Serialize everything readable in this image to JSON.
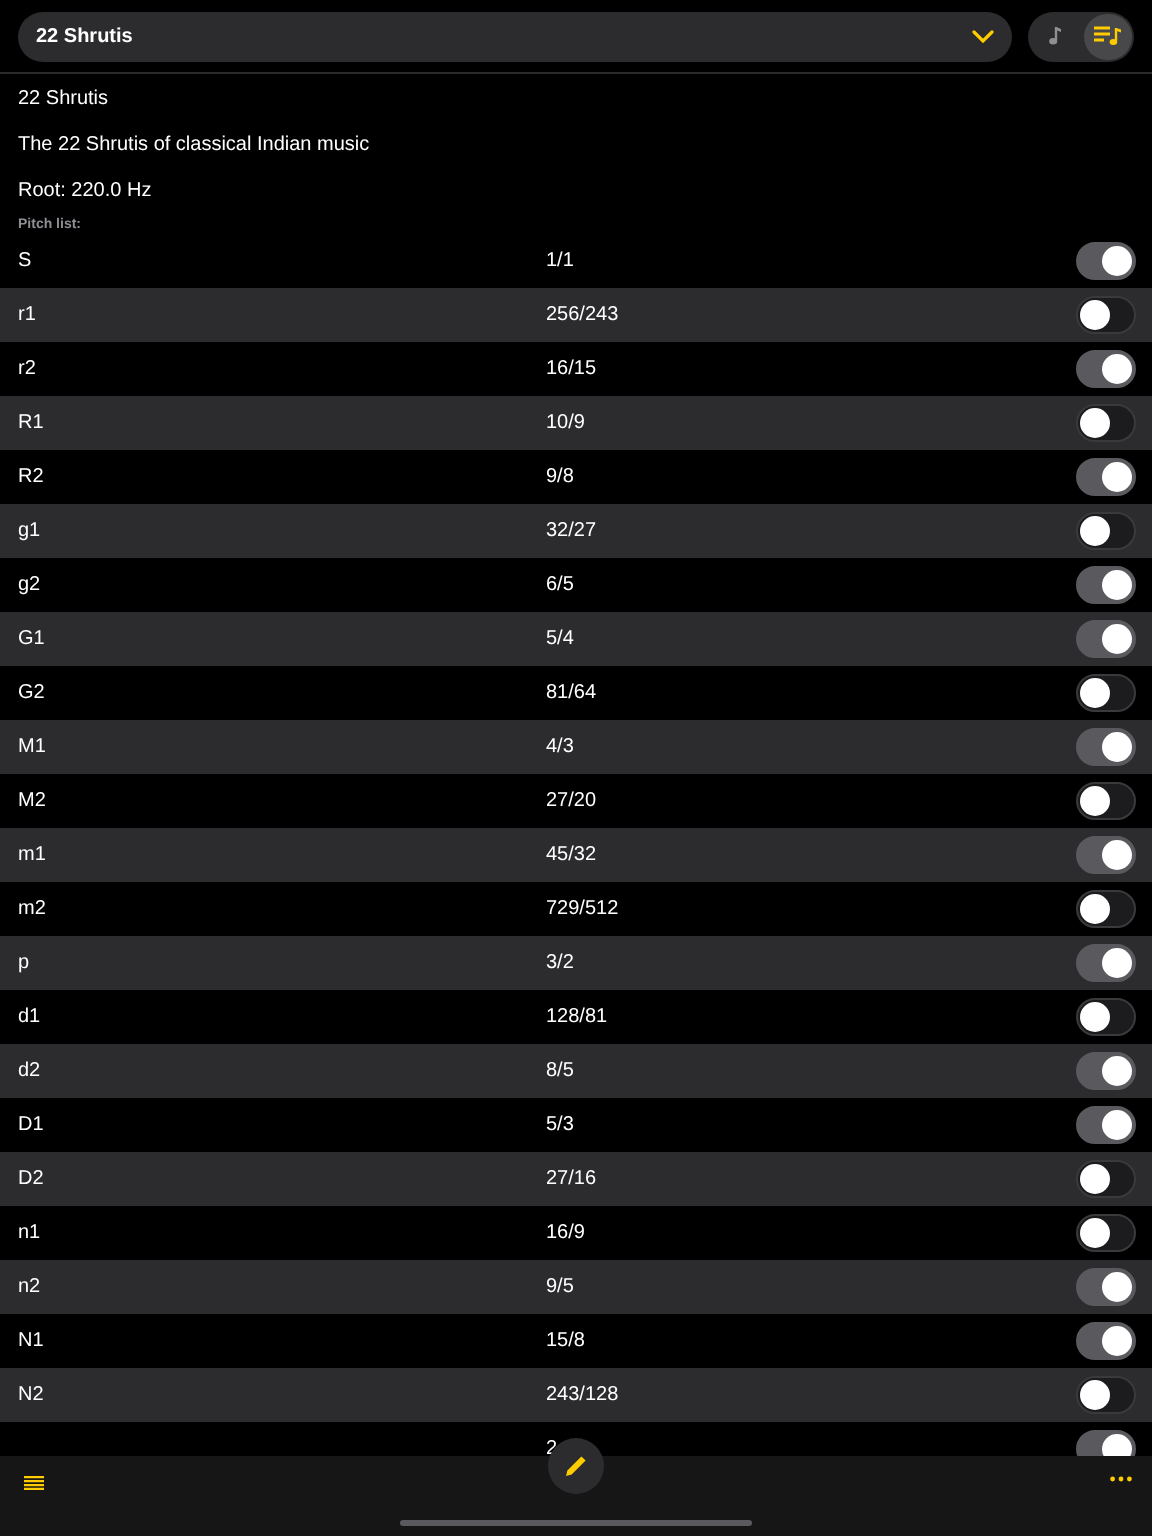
{
  "scale_picker": {
    "value": "22 Shrutis"
  },
  "mode_buttons": [
    {
      "kind": "note",
      "selected": false
    },
    {
      "kind": "list",
      "selected": true
    }
  ],
  "info": [
    "22 Shrutis",
    "The 22 Shrutis of classical Indian music",
    "Root: 220.0 Hz"
  ],
  "pitch_list_label": "Pitch list:",
  "pitches": [
    {
      "name": "S",
      "ratio": "1/1",
      "on": true
    },
    {
      "name": "r1",
      "ratio": "256/243",
      "on": false
    },
    {
      "name": "r2",
      "ratio": "16/15",
      "on": true
    },
    {
      "name": "R1",
      "ratio": "10/9",
      "on": false
    },
    {
      "name": "R2",
      "ratio": "9/8",
      "on": true
    },
    {
      "name": "g1",
      "ratio": "32/27",
      "on": false
    },
    {
      "name": "g2",
      "ratio": "6/5",
      "on": true
    },
    {
      "name": "G1",
      "ratio": "5/4",
      "on": true
    },
    {
      "name": "G2",
      "ratio": "81/64",
      "on": false
    },
    {
      "name": "M1",
      "ratio": "4/3",
      "on": true
    },
    {
      "name": "M2",
      "ratio": "27/20",
      "on": false
    },
    {
      "name": "m1",
      "ratio": "45/32",
      "on": true
    },
    {
      "name": "m2",
      "ratio": "729/512",
      "on": false
    },
    {
      "name": "p",
      "ratio": "3/2",
      "on": true
    },
    {
      "name": "d1",
      "ratio": "128/81",
      "on": false
    },
    {
      "name": "d2",
      "ratio": "8/5",
      "on": true
    },
    {
      "name": "D1",
      "ratio": "5/3",
      "on": true
    },
    {
      "name": "D2",
      "ratio": "27/16",
      "on": false
    },
    {
      "name": "n1",
      "ratio": "16/9",
      "on": false
    },
    {
      "name": "n2",
      "ratio": "9/5",
      "on": true
    },
    {
      "name": "N1",
      "ratio": "15/8",
      "on": true
    },
    {
      "name": "N2",
      "ratio": "243/128",
      "on": false
    },
    {
      "ratio": "2",
      "on": true
    }
  ]
}
